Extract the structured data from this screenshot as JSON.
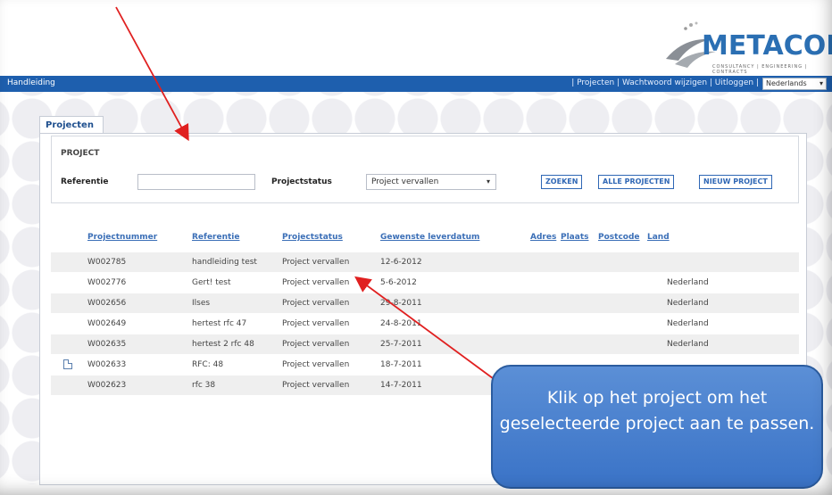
{
  "logo": {
    "text": "METACON",
    "tagline": "CONSULTANCY | ENGINEERING | CONTRACTS"
  },
  "navbar": {
    "left_link": "Handleiding",
    "right_links": [
      "Projecten",
      "Wachtwoord wijzigen",
      "Uitloggen"
    ],
    "language": "Nederlands",
    "color": "#1e5fae"
  },
  "tab": {
    "label": "Projecten"
  },
  "search": {
    "section_title": "PROJECT",
    "referentie_label": "Referentie",
    "referentie_value": "",
    "projectstatus_label": "Projectstatus",
    "projectstatus_value": "Project vervallen",
    "buttons": {
      "zoeken": "ZOEKEN",
      "alle": "ALLE PROJECTEN",
      "nieuw": "NIEUW PROJECT"
    }
  },
  "table": {
    "headers": [
      "Projectnummer",
      "Referentie",
      "Projectstatus",
      "Gewenste leverdatum",
      "Adres",
      "Plaats",
      "Postcode",
      "Land"
    ],
    "rows": [
      {
        "nummer": "W002785",
        "referentie": "handleiding test",
        "status": "Project vervallen",
        "datum": "12-6-2012",
        "land": ""
      },
      {
        "nummer": "W002776",
        "referentie": "Gert! test",
        "status": "Project vervallen",
        "datum": "5-6-2012",
        "land": "Nederland"
      },
      {
        "nummer": "W002656",
        "referentie": "Ilses",
        "status": "Project vervallen",
        "datum": "29-8-2011",
        "land": "Nederland"
      },
      {
        "nummer": "W002649",
        "referentie": "hertest rfc 47",
        "status": "Project vervallen",
        "datum": "24-8-2011",
        "land": "Nederland"
      },
      {
        "nummer": "W002635",
        "referentie": "hertest 2 rfc 48",
        "status": "Project vervallen",
        "datum": "25-7-2011",
        "land": "Nederland"
      },
      {
        "nummer": "W002633",
        "referentie": "RFC: 48",
        "status": "Project vervallen",
        "datum": "18-7-2011",
        "land": ""
      },
      {
        "nummer": "W002623",
        "referentie": "rfc 38",
        "status": "Project vervallen",
        "datum": "14-7-2011",
        "land": ""
      }
    ]
  },
  "callout": {
    "text": "Klik op het project om het geselecteerde project aan te passen."
  },
  "annotation_color": "#e02020"
}
